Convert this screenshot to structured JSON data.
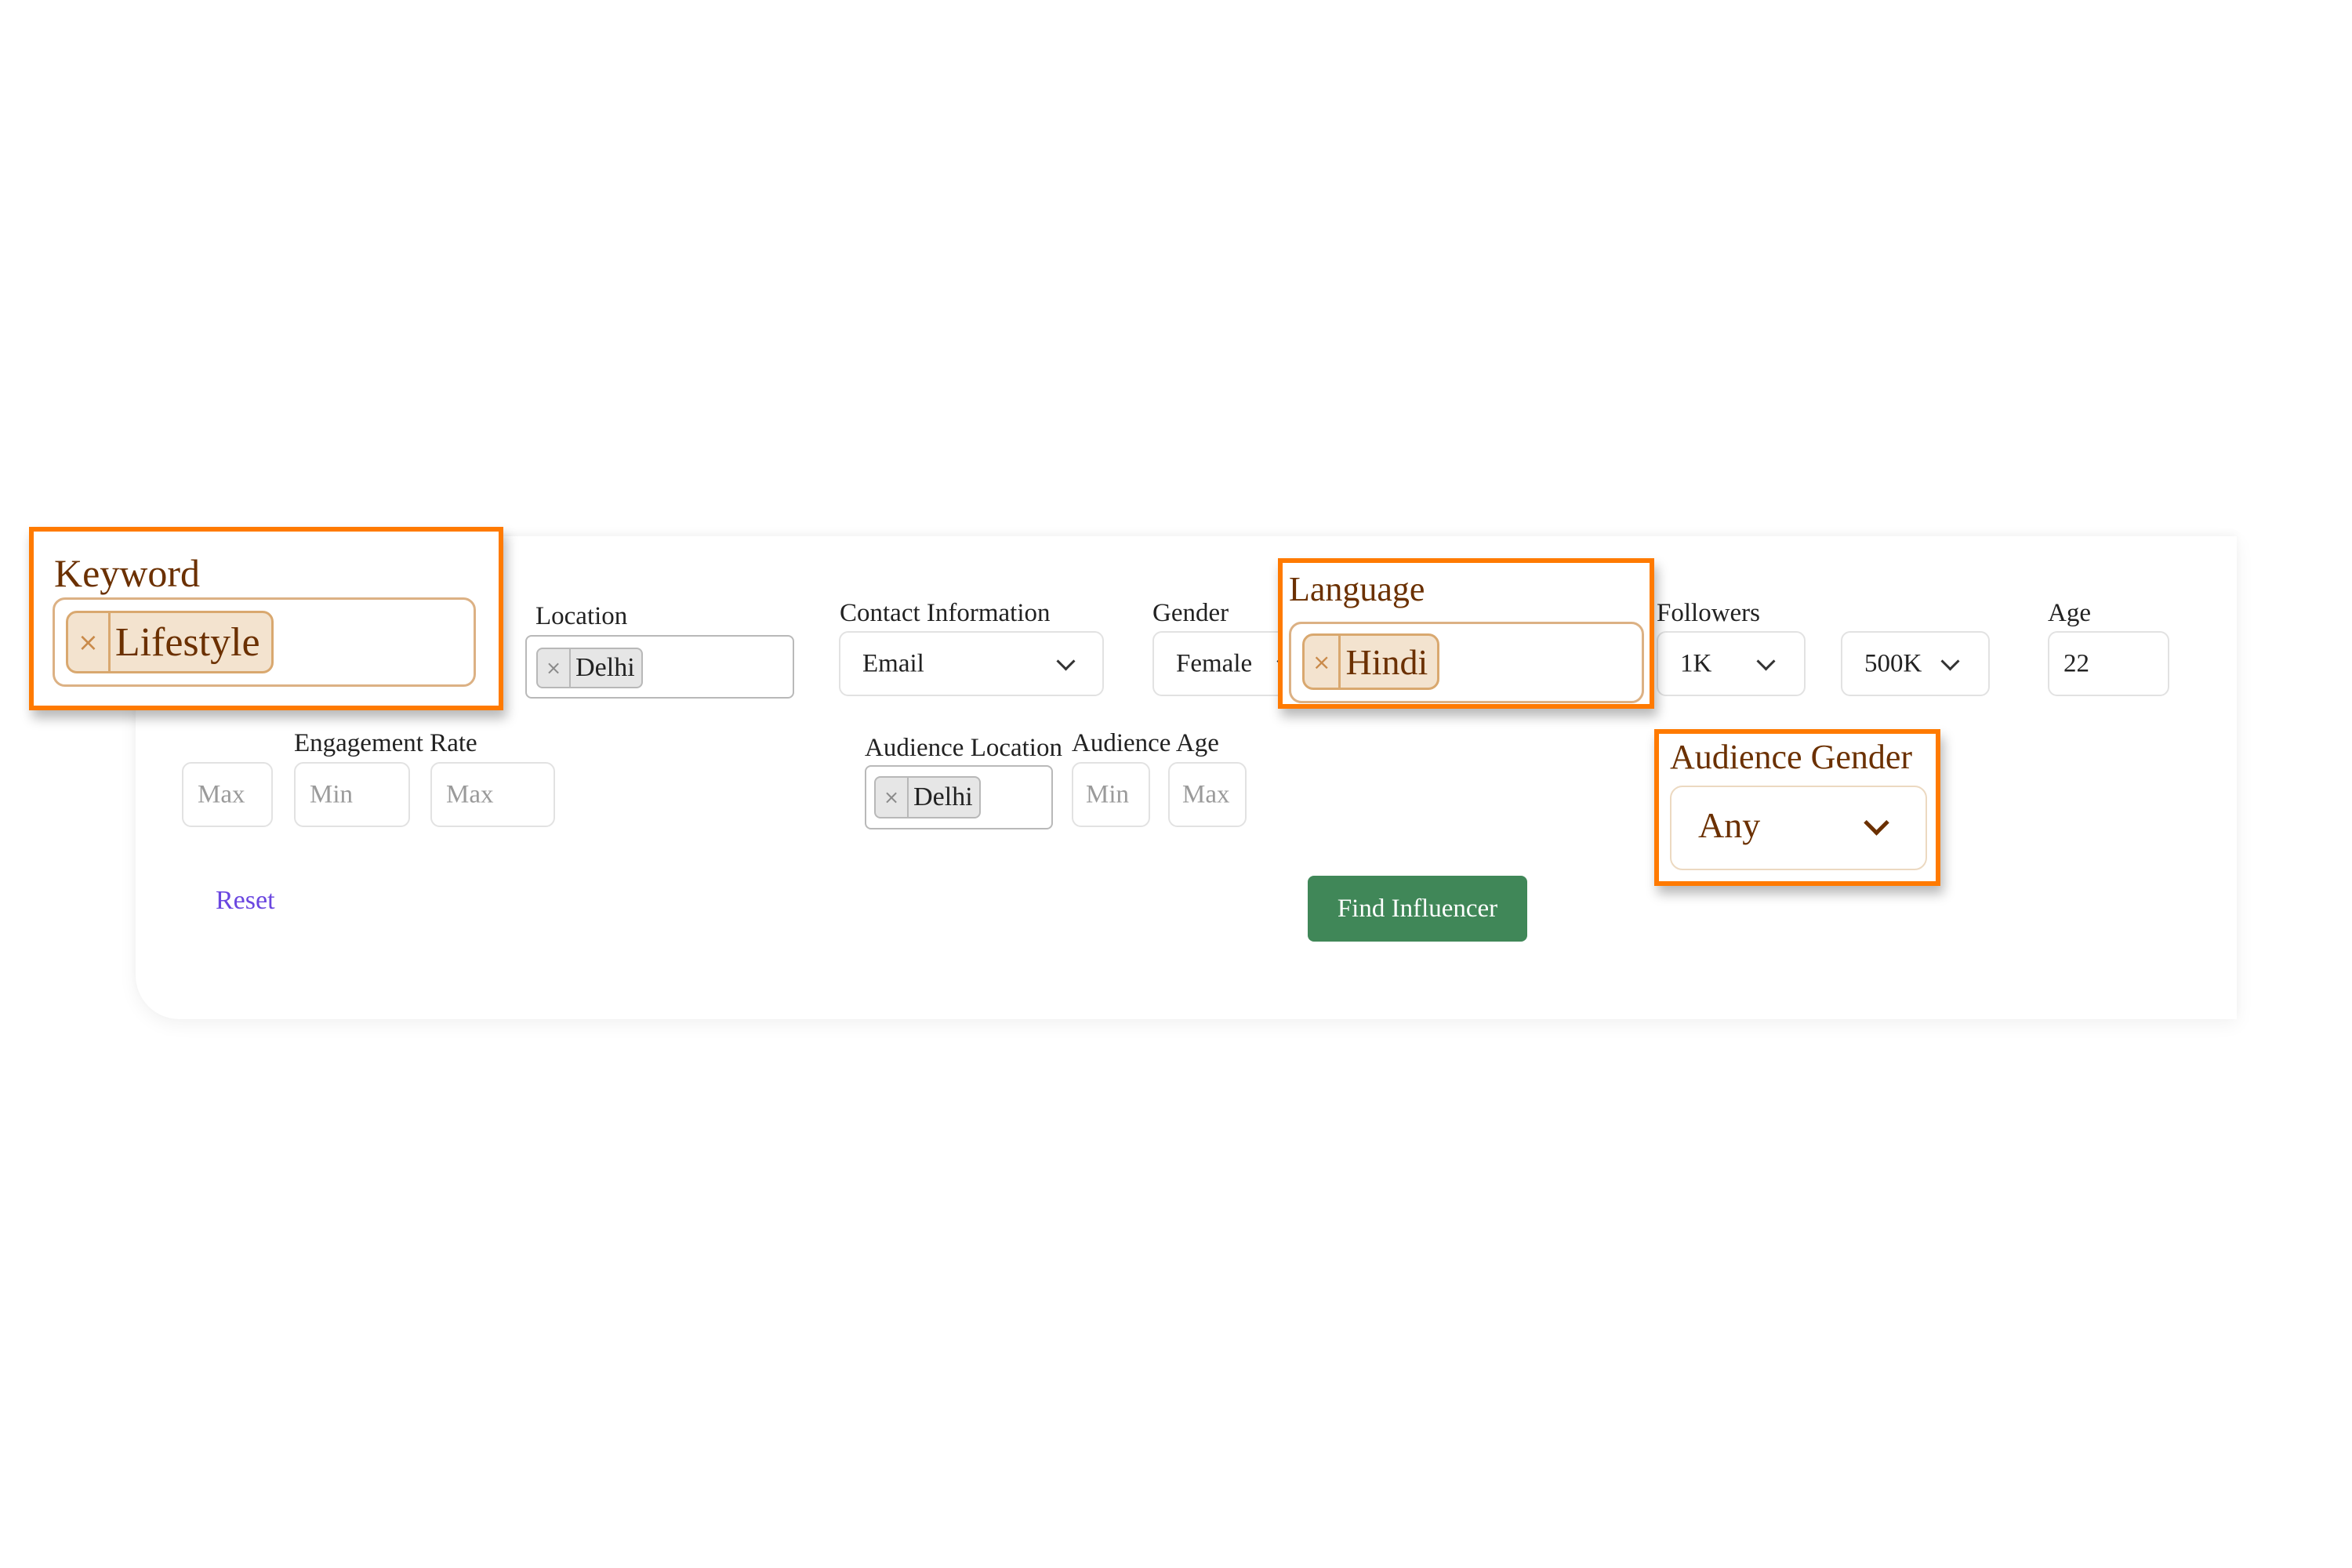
{
  "filters": {
    "keyword": {
      "label": "Keyword",
      "tags": [
        "Lifestyle"
      ]
    },
    "location": {
      "label": "Location",
      "tags": [
        "Delhi"
      ]
    },
    "contact_information": {
      "label": "Contact Information",
      "selected": "Email"
    },
    "gender": {
      "label": "Gender",
      "selected": "Female"
    },
    "language": {
      "label": "Language",
      "tags": [
        "Hindi"
      ]
    },
    "followers": {
      "label": "Followers",
      "min_selected": "1K",
      "max_selected": "500K"
    },
    "age": {
      "label": "Age",
      "value": "22"
    },
    "age_max_placeholder": "Max",
    "engagement_rate": {
      "label": "Engagement Rate",
      "min_placeholder": "Min",
      "max_placeholder": "Max"
    },
    "audience_location": {
      "label": "Audience Location",
      "tags": [
        "Delhi"
      ]
    },
    "audience_age": {
      "label": "Audience Age",
      "min_placeholder": "Min",
      "max_placeholder": "Max"
    },
    "audience_gender": {
      "label": "Audience Gender",
      "selected": "Any"
    }
  },
  "actions": {
    "reset_label": "Reset",
    "find_label": "Find Influencer"
  },
  "tag_remove_glyph": "×",
  "colors": {
    "highlight_border": "#ff7a00",
    "find_button": "#408758",
    "reset_link": "#6a46e0",
    "highlight_text": "#6b3000",
    "highlight_tag_bg": "#f3e3cf"
  }
}
